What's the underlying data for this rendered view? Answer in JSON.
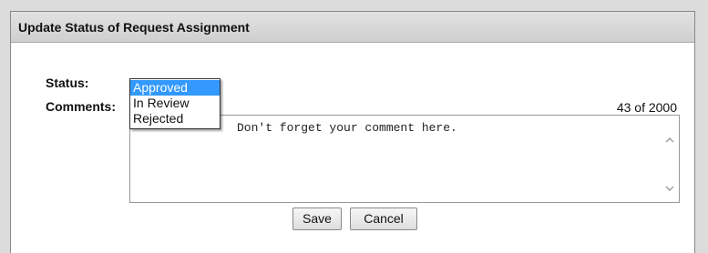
{
  "dialog": {
    "title": "Update Status of Request Assignment"
  },
  "form": {
    "status_label": "Status:",
    "comments_label": "Comments:",
    "status_options": [
      "Approved",
      "In Review",
      "Rejected"
    ],
    "status_selected": "Approved",
    "char_counter": "43 of 2000",
    "comment_text": "Don't forget your comment here."
  },
  "buttons": {
    "save_label": "Save",
    "cancel_label": "Cancel"
  },
  "colors": {
    "selection": "#3399ff",
    "titlebar": "#d6d6d6"
  },
  "icons": {
    "scroll_up": "chevron-up-icon",
    "scroll_down": "chevron-down-icon"
  }
}
